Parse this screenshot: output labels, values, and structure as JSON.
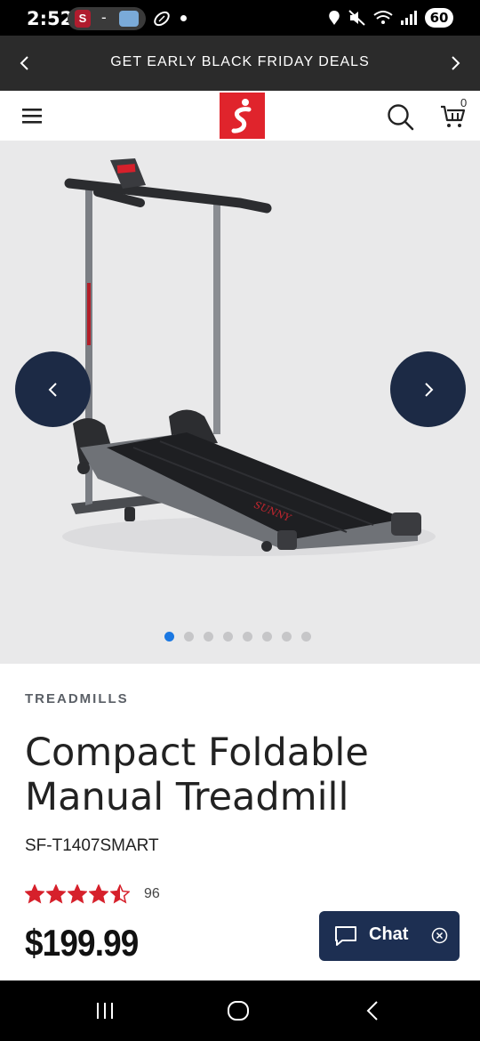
{
  "status_bar": {
    "time": "2:52",
    "pill_separator": "-",
    "app_badge_letter": "S",
    "battery": "60",
    "icons": [
      "stanford-app-icon",
      "unc-app-icon",
      "football-icon",
      "notification-dot",
      "location-icon",
      "mute-icon",
      "wifi-icon",
      "signal-icon",
      "battery-icon"
    ]
  },
  "promo": {
    "text": "GET EARLY BLACK FRIDAY DEALS",
    "icons": [
      "chevron-left-icon",
      "chevron-right-icon"
    ]
  },
  "header": {
    "logo_letter": "S",
    "cart_count": "0",
    "icons": [
      "hamburger-menu-icon",
      "search-icon",
      "cart-icon"
    ],
    "brand_color": "#e0242c"
  },
  "gallery": {
    "image": "compact-foldable-manual-treadmill",
    "dot_count": 8,
    "active_dot": 0,
    "arrow_color": "#1c2a45",
    "active_dot_color": "#1b78e2"
  },
  "product": {
    "category": "TREADMILLS",
    "title": "Compact Foldable Manual Treadmill",
    "sku": "SF-T1407SMART",
    "rating": 4.5,
    "review_count": "96",
    "price": "$199.99",
    "star_color": "#d6202b"
  },
  "chat": {
    "label": "Chat",
    "icons": [
      "chat-bubble-icon",
      "close-circle-icon"
    ]
  },
  "nav_bar": {
    "icons": [
      "recent-apps-icon",
      "home-icon",
      "back-icon"
    ]
  }
}
